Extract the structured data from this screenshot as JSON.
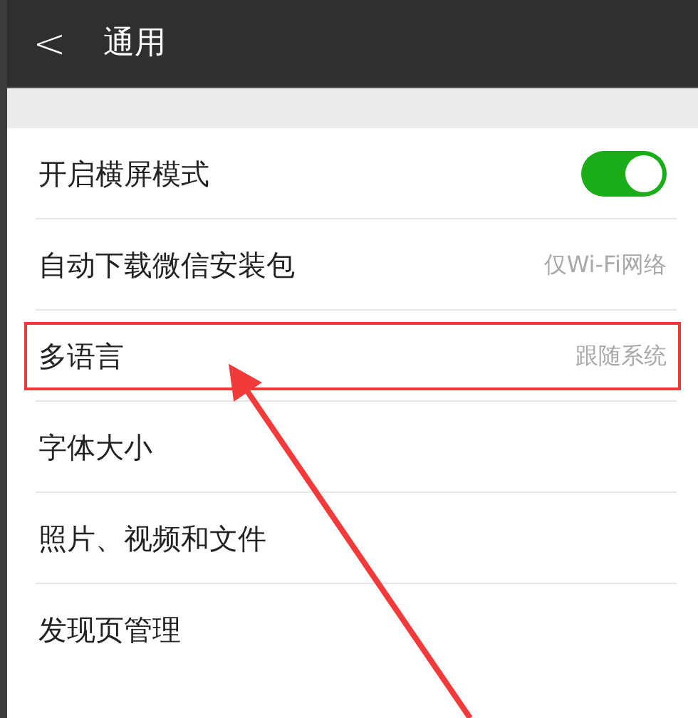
{
  "header": {
    "back": "<",
    "title": "通用"
  },
  "items": [
    {
      "kind": "toggle",
      "label": "开启横屏模式",
      "on": true,
      "highlighted": false
    },
    {
      "kind": "value",
      "label": "自动下载微信安装包",
      "value": "仅Wi-Fi网络",
      "highlighted": false
    },
    {
      "kind": "value",
      "label": "多语言",
      "value": "跟随系统",
      "highlighted": true
    },
    {
      "kind": "plain",
      "label": "字体大小",
      "highlighted": false
    },
    {
      "kind": "plain",
      "label": "照片、视频和文件",
      "highlighted": false
    },
    {
      "kind": "plain",
      "label": "发现页管理",
      "highlighted": false
    }
  ]
}
